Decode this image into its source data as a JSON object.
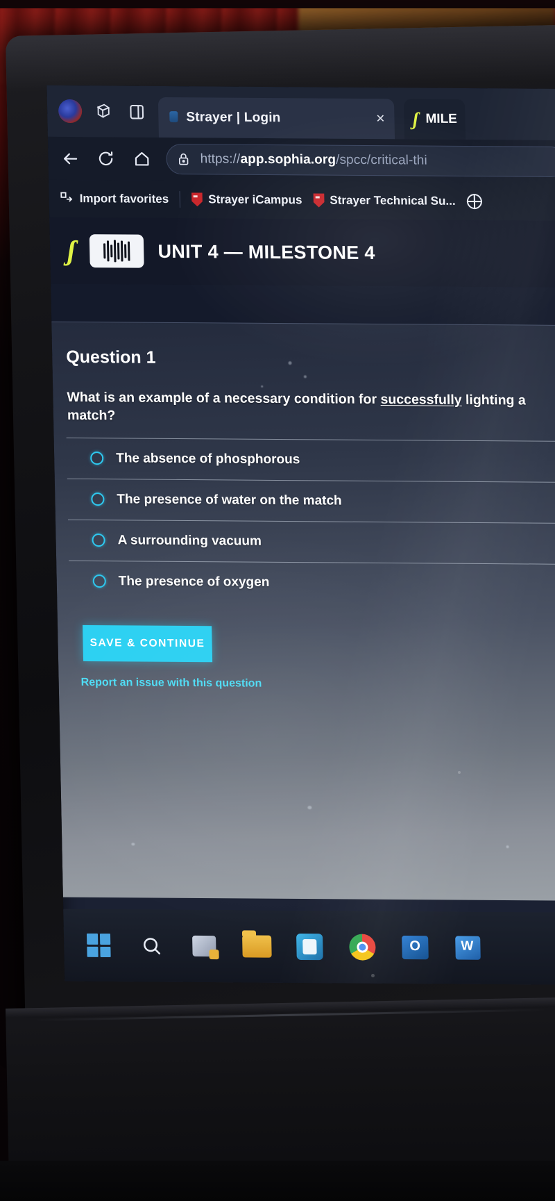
{
  "browser": {
    "tabs": [
      {
        "title": "Strayer | Login",
        "close_label": "×",
        "active": true
      },
      {
        "title": "MILE",
        "favicon": "sophia-logo-icon",
        "active": false
      }
    ],
    "toolbar": {
      "back_icon": "back-arrow-icon",
      "reload_icon": "reload-icon",
      "home_icon": "home-icon",
      "lock_icon": "lock-icon",
      "url_scheme": "https://",
      "url_host": "app.sophia.org",
      "url_path": "/spcc/critical-thi"
    },
    "bookmarks": [
      {
        "label": "Import favorites",
        "icon": "import-favorites-icon"
      },
      {
        "label": "Strayer iCampus",
        "icon": "strayer-shield-icon"
      },
      {
        "label": "Strayer Technical Su...",
        "icon": "strayer-shield-icon"
      },
      {
        "label": "",
        "icon": "globe-icon"
      }
    ],
    "window_icons": [
      "profile-avatar-icon",
      "collections-icon",
      "split-screen-icon"
    ]
  },
  "app": {
    "logo": "ʃ",
    "badge_icon": "milestone-badge-icon",
    "unit_title": "UNIT 4 — MILESTONE 4"
  },
  "question": {
    "number_label": "Question 1",
    "prompt_before": "What is an example of a necessary condition for ",
    "prompt_emphasis": "successfully",
    "prompt_after": " lighting a match?",
    "options": [
      {
        "label": "The absence of phosphorous",
        "selected": false
      },
      {
        "label": "The presence of water on the match",
        "selected": false
      },
      {
        "label": "A surrounding vacuum",
        "selected": false
      },
      {
        "label": "The presence of oxygen",
        "selected": false
      }
    ],
    "save_button": "SAVE & CONTINUE",
    "report_link": "Report an issue with this question"
  },
  "taskbar": {
    "items": [
      {
        "name": "start-button",
        "icon": "windows-logo-icon"
      },
      {
        "name": "search-button",
        "icon": "search-icon"
      },
      {
        "name": "widgets-button",
        "icon": "widgets-icon"
      },
      {
        "name": "file-explorer-button",
        "icon": "folder-icon"
      },
      {
        "name": "microsoft-store-button",
        "icon": "store-icon"
      },
      {
        "name": "chrome-button",
        "icon": "chrome-icon"
      },
      {
        "name": "outlook-button",
        "icon": "outlook-icon"
      },
      {
        "name": "word-button",
        "icon": "word-icon"
      }
    ]
  },
  "colors": {
    "accent_cyan": "#2bd0f2",
    "sophia_yellow": "#dff245",
    "strayer_red": "#c9262b",
    "tab_bar": "#1e2535",
    "question_panel_top": "#242b3d"
  }
}
